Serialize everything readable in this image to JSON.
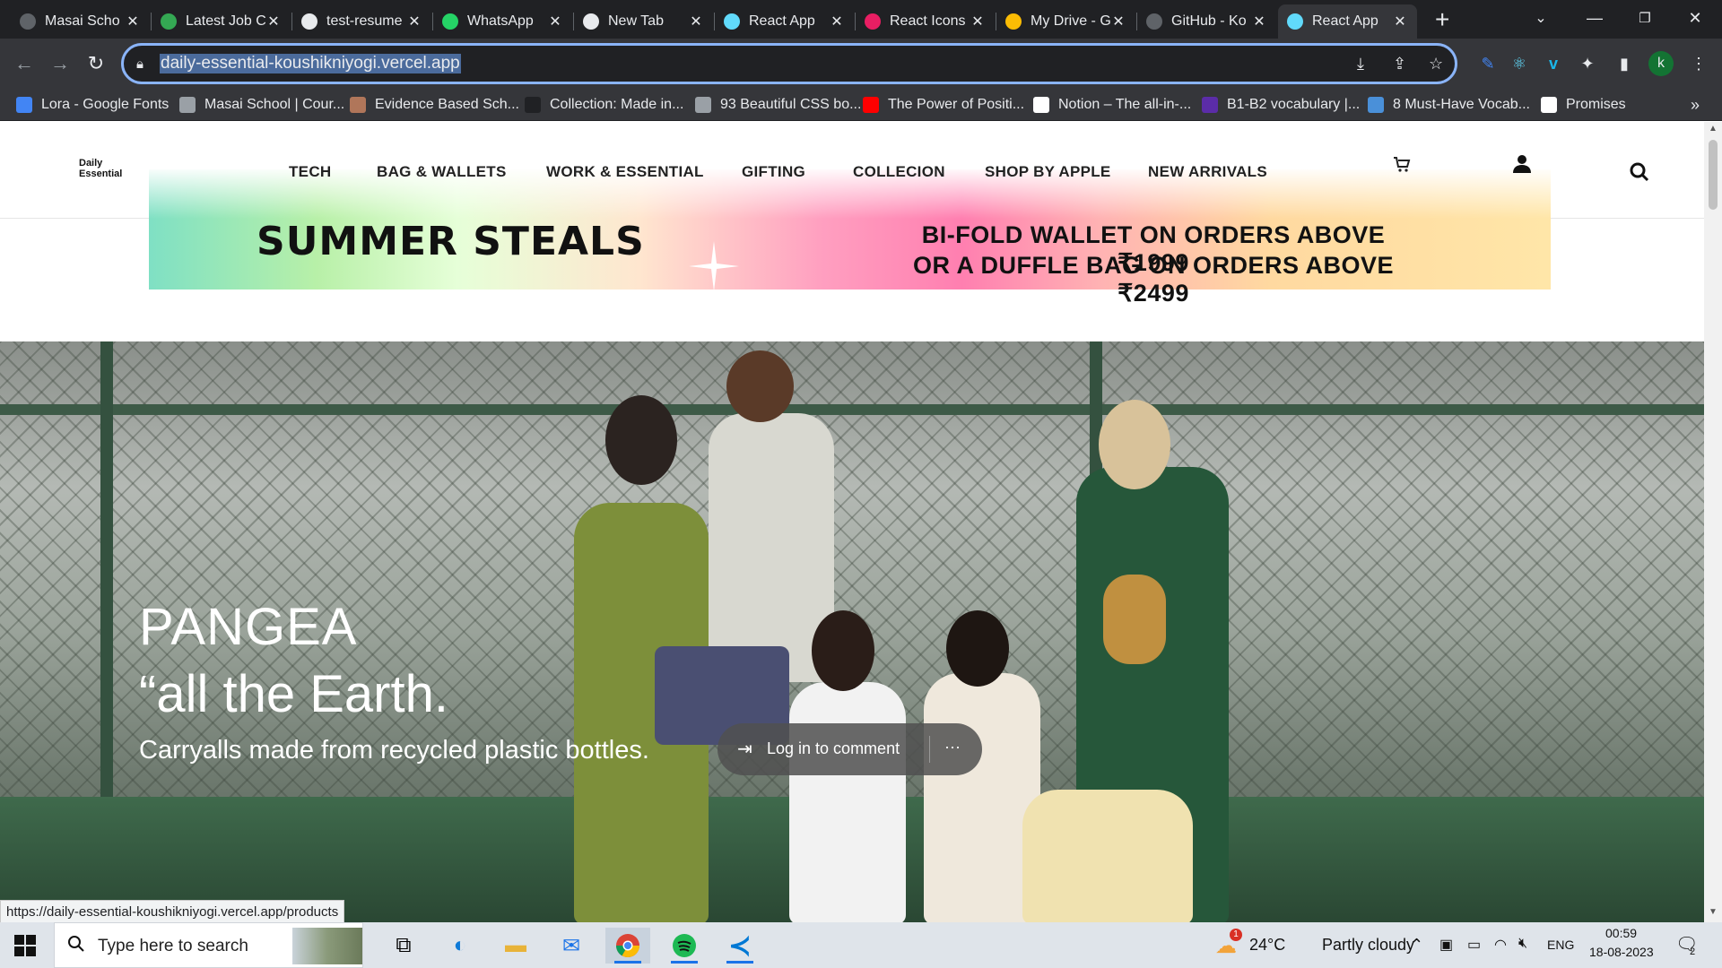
{
  "browser": {
    "tabs": [
      {
        "label": "Masai Scho",
        "color": "#5f6368"
      },
      {
        "label": "Latest Job C",
        "color": "#34a853"
      },
      {
        "label": "test-resume",
        "color": "#e8eaed"
      },
      {
        "label": "WhatsApp",
        "color": "#25d366"
      },
      {
        "label": "New Tab",
        "color": "#e8eaed"
      },
      {
        "label": "React App",
        "color": "#61dafb"
      },
      {
        "label": "React Icons",
        "color": "#e91e63"
      },
      {
        "label": "My Drive - G",
        "color": "#fbbc04"
      },
      {
        "label": "GitHub - Ko",
        "color": "#5f6368"
      },
      {
        "label": "React App",
        "color": "#61dafb",
        "active": true
      }
    ],
    "close_glyph": "✕",
    "new_tab_glyph": "+",
    "url": "daily-essential-koushikniyogi.vercel.app",
    "profile_initial": "k",
    "bookmarks": [
      {
        "label": "Lora - Google Fonts",
        "color": "#4285f4"
      },
      {
        "label": "Masai School | Cour...",
        "color": "#9aa0a6"
      },
      {
        "label": "Evidence Based Sch...",
        "color": "#b0765a"
      },
      {
        "label": "Collection: Made in...",
        "color": "#202124"
      },
      {
        "label": "93 Beautiful CSS bo...",
        "color": "#9aa0a6"
      },
      {
        "label": "The Power of Positi...",
        "color": "#ff0000"
      },
      {
        "label": "Notion – The all-in-...",
        "color": "#ffffff"
      },
      {
        "label": "B1-B2 vocabulary |...",
        "color": "#5b2ca8"
      },
      {
        "label": "8 Must-Have Vocab...",
        "color": "#4a90d9"
      },
      {
        "label": "Promises",
        "color": "#ffffff"
      }
    ],
    "bookmarks_overflow": "»",
    "status_url": "https://daily-essential-koushikniyogi.vercel.app/products"
  },
  "site": {
    "logo_line1": "Daily",
    "logo_line2": "Essential",
    "nav": [
      "TECH",
      "BAG & WALLETS",
      "WORK & ESSENTIAL",
      "GIFTING",
      "COLLECION",
      "SHOP BY APPLE",
      "NEW ARRIVALS"
    ],
    "banner": {
      "headline": "SUMMER STEALS",
      "line1": "BI-FOLD WALLET ON ORDERS ABOVE ₹1999",
      "line2": "OR A DUFFLE BAG ON ORDERS ABOVE ₹2499"
    },
    "hero": {
      "title": "PANGEA",
      "quote": "“all the Earth.",
      "subtitle": "Carryalls made from recycled plastic bottles."
    },
    "comment": {
      "label": "Log in to comment",
      "more": "···"
    }
  },
  "taskbar": {
    "search_placeholder": "Type here to search",
    "weather_temp": "24°C",
    "weather_desc": "Partly cloudy",
    "weather_badge": "1",
    "language": "ENG",
    "time": "00:59",
    "date": "18-08-2023",
    "notification_count": "2"
  },
  "colors": {
    "accent": "#8ab4f8",
    "chrome_dark": "#202124",
    "chrome_toolbar": "#35363a"
  }
}
